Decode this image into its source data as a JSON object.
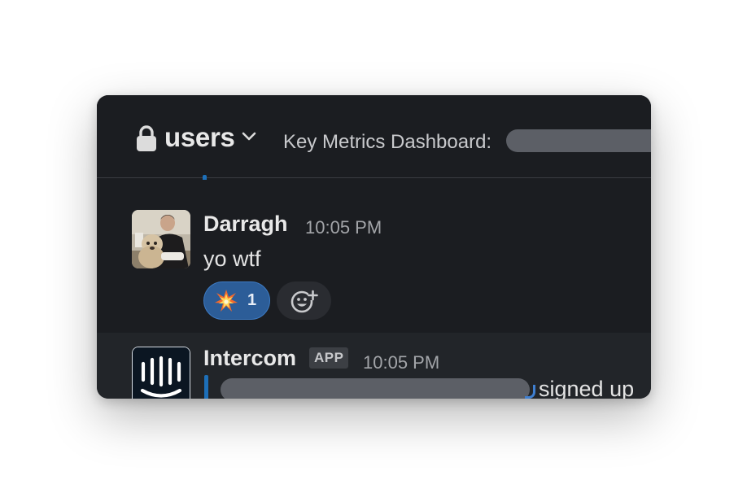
{
  "header": {
    "channel_name": "users",
    "lock_icon": "lock-icon",
    "dropdown_icon": "chevron-down-icon",
    "topic": "Key Metrics Dashboard:"
  },
  "messages": [
    {
      "sender": "Darragh",
      "time": "10:05 PM",
      "text": "yo wtf",
      "avatar": "user-avatar-photo",
      "reactions": [
        {
          "emoji": "collision-emoji",
          "count": "1"
        }
      ],
      "add_reaction_icon": "add-reaction-icon"
    },
    {
      "sender": "Intercom",
      "badge": "APP",
      "time": "10:05 PM",
      "avatar": "intercom-logo",
      "text_suffix": "signed up"
    }
  ],
  "colors": {
    "background": "#1b1d21",
    "highlight_row": "#222529",
    "reaction_selected": "#2c5d98",
    "link_accent": "#1d6fb8",
    "redaction": "#5c5f66"
  }
}
